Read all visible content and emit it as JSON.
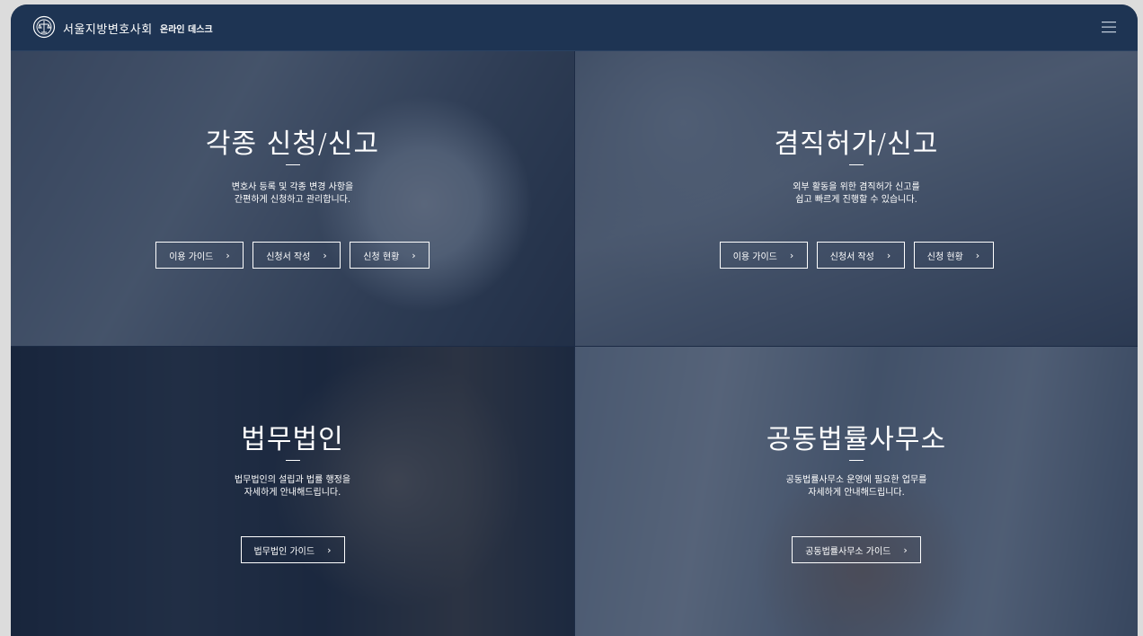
{
  "header": {
    "brand_name": "서울지방변호사회",
    "brand_sub": "온라인 데스크",
    "logo_icon": "bar-association-emblem-icon",
    "menu_icon": "hamburger-menu-icon"
  },
  "panels": [
    {
      "title": "각종 신청/신고",
      "desc_line1": "변호사 등록 및 각종 변경 사항을",
      "desc_line2": "간편하게 신청하고 관리합니다.",
      "buttons": [
        {
          "label": "이용 가이드",
          "icon": "chevron-right-icon"
        },
        {
          "label": "신청서 작성",
          "icon": "chevron-right-icon"
        },
        {
          "label": "신청 현황",
          "icon": "chevron-right-icon"
        }
      ]
    },
    {
      "title": "겸직허가/신고",
      "desc_line1": "외부 활동을 위한 겸직허가 신고를",
      "desc_line2": "쉽고 빠르게 진행할 수 있습니다.",
      "buttons": [
        {
          "label": "이용 가이드",
          "icon": "chevron-right-icon"
        },
        {
          "label": "신청서 작성",
          "icon": "chevron-right-icon"
        },
        {
          "label": "신청 현황",
          "icon": "chevron-right-icon"
        }
      ]
    },
    {
      "title": "법무법인",
      "desc_line1": "법무법인의 설립과 법률 행정을",
      "desc_line2": "자세하게 안내해드립니다.",
      "buttons": [
        {
          "label": "법무법인 가이드",
          "icon": "chevron-right-icon"
        }
      ]
    },
    {
      "title": "공동법률사무소",
      "desc_line1": "공동법률사무소 운영에 필요한 업무를",
      "desc_line2": "자세하게 안내해드립니다.",
      "buttons": [
        {
          "label": "공동법률사무소 가이드",
          "icon": "chevron-right-icon"
        }
      ]
    }
  ],
  "chevron": "›",
  "colors": {
    "header_bg": "#1e3453",
    "overlay": "#162642"
  }
}
